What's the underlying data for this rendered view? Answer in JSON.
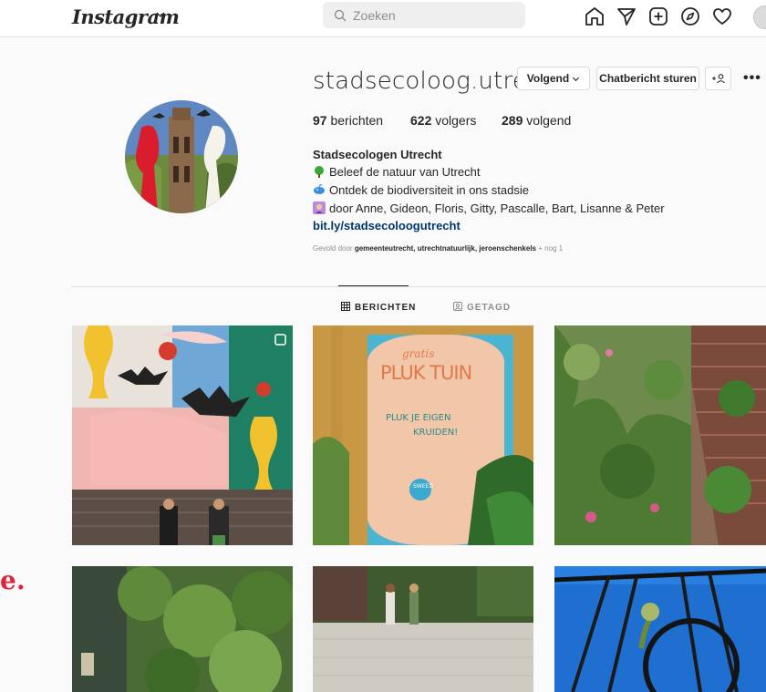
{
  "app": {
    "logo_text": "Instagram"
  },
  "search": {
    "placeholder": "Zoeken"
  },
  "nav_icons": [
    "home-icon",
    "direct-icon",
    "new-post-icon",
    "explore-icon",
    "activity-heart-icon",
    "profile-avatar"
  ],
  "profile": {
    "username": "stadsecoloog.utrecht",
    "follow_button": "Volgend",
    "message_button": "Chatbericht sturen",
    "suggest_button": "+2",
    "more": "•••",
    "stats": {
      "posts_num": "97",
      "posts_label": "berichten",
      "followers_num": "622",
      "followers_label": "volgers",
      "following_num": "289",
      "following_label": "volgend"
    },
    "full_name": "Stadsecologen Utrecht",
    "bio_lines": [
      "Beleef de natuur van Utrecht",
      "Ontdek de biodiversiteit in ons stadsie",
      "door Anne, Gideon, Floris, Gitty, Pascalle, Bart, Lisanne & Peter"
    ],
    "link": "bit.ly/stadsecoloogutrecht",
    "followed_by_prefix": "Gevold door",
    "followed_by_names": "gemeenteutrecht, utrechtnatuurlijk, jeroenschenkels",
    "followed_by_suffix": "+ nog 1"
  },
  "tabs": [
    {
      "label": "BERICHTEN",
      "active": true
    },
    {
      "label": "GETAGD",
      "active": false
    }
  ],
  "posts": {
    "poster_text_1": "gratis",
    "poster_text_2": "PLUK TUIN",
    "poster_text_3": "PLUK JE EIGEN",
    "poster_text_4": "KRUIDEN!",
    "poster_badge": "SWEED"
  },
  "side_artifact": "e.",
  "colors": {
    "link": "#00376b",
    "muted": "#8e8e8e",
    "border": "#dbdbdb"
  }
}
